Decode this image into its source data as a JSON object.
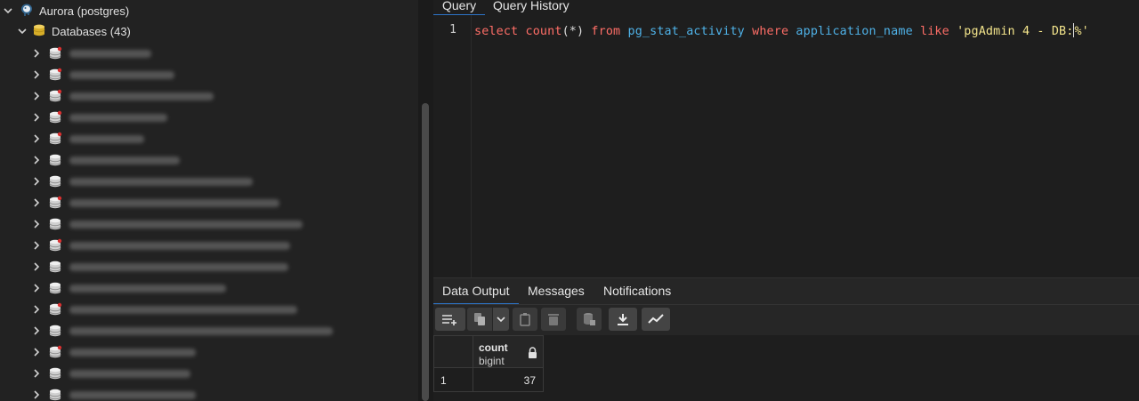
{
  "tree": {
    "server_label": "Aurora (postgres)",
    "databases_label": "Databases (43)",
    "database_rows": [
      {
        "name_redacted": true
      },
      {
        "name_redacted": true
      },
      {
        "name_redacted": true
      },
      {
        "name_redacted": true
      },
      {
        "name_redacted": true
      },
      {
        "name_redacted": true
      },
      {
        "name_redacted": true
      },
      {
        "name_redacted": true
      },
      {
        "name_redacted": true
      },
      {
        "name_redacted": true
      },
      {
        "name_redacted": true
      },
      {
        "name_redacted": true
      },
      {
        "name_redacted": true
      },
      {
        "name_redacted": true
      },
      {
        "name_redacted": true
      },
      {
        "name_redacted": true
      },
      {
        "name_redacted": true
      }
    ]
  },
  "query_tabs": [
    "Query",
    "Query History"
  ],
  "editor": {
    "line_number": "1",
    "tokens": {
      "select": "select",
      "count": "count",
      "args": "(*)",
      "from": "from",
      "table": "pg_stat_activity",
      "where": "where",
      "column": "application_name",
      "like": "like",
      "string_before_caret": "'pgAdmin 4 - DB:",
      "string_after_caret": "%'"
    }
  },
  "output_tabs": [
    "Data Output",
    "Messages",
    "Notifications"
  ],
  "result": {
    "column_name": "count",
    "column_type": "bigint",
    "rows": [
      {
        "row": "1",
        "count": "37"
      }
    ]
  },
  "colors": {
    "accent": "#2d74c7",
    "keyword": "#ff6e67",
    "identifier": "#4fb2e8",
    "string": "#f3e48b"
  }
}
